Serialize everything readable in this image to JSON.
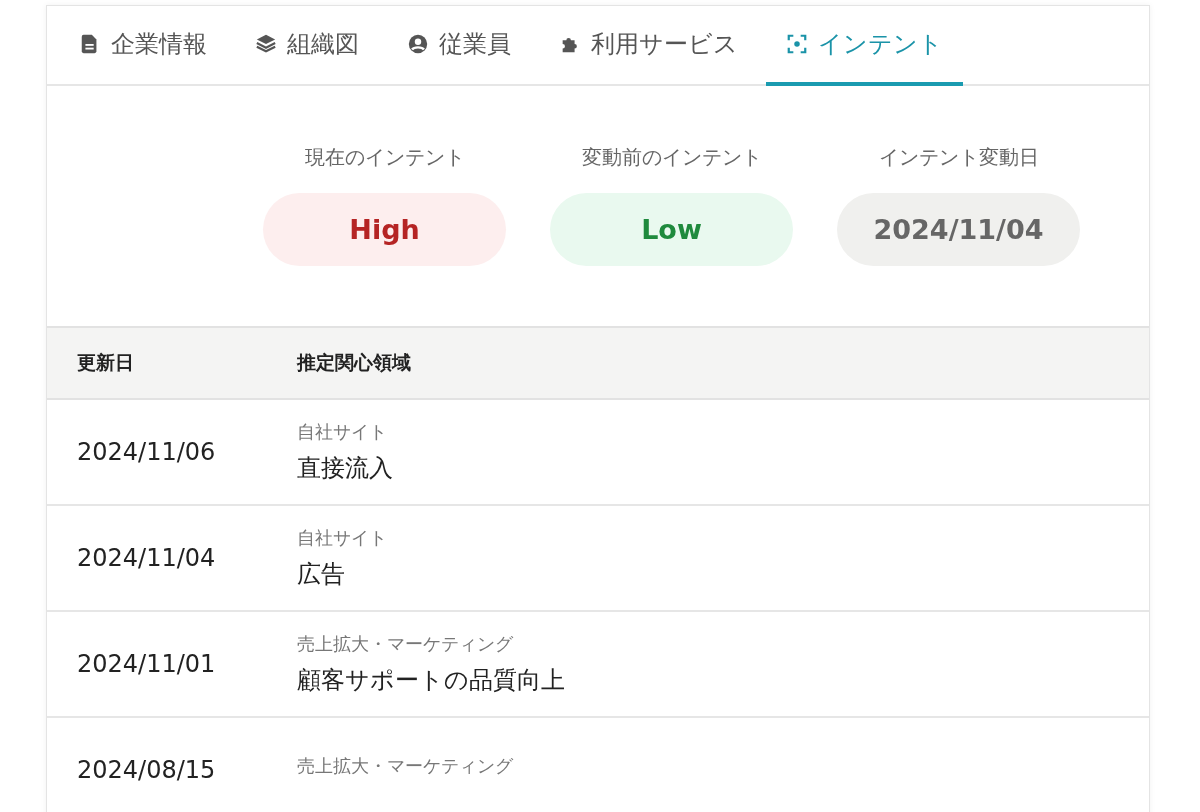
{
  "tabs": [
    {
      "label": "企業情報",
      "selected": false
    },
    {
      "label": "組織図",
      "selected": false
    },
    {
      "label": "従業員",
      "selected": false
    },
    {
      "label": "利用サービス",
      "selected": false
    },
    {
      "label": "インテント",
      "selected": true
    }
  ],
  "intent_summary": [
    {
      "label": "現在のインテント",
      "value": "High",
      "kind": "high"
    },
    {
      "label": "変動前のインテント",
      "value": "Low",
      "kind": "low"
    },
    {
      "label": "インテント変動日",
      "value": "2024/11/04",
      "kind": "date"
    }
  ],
  "table": {
    "columns": [
      "更新日",
      "推定関心領域"
    ],
    "rows": [
      {
        "date": "2024/11/06",
        "category": "自社サイト",
        "topic": "直接流入"
      },
      {
        "date": "2024/11/04",
        "category": "自社サイト",
        "topic": "広告"
      },
      {
        "date": "2024/11/01",
        "category": "売上拡大・マーケティング",
        "topic": "顧客サポートの品質向上"
      },
      {
        "date": "2024/08/15",
        "category": "売上拡大・マーケティング"
      }
    ]
  }
}
